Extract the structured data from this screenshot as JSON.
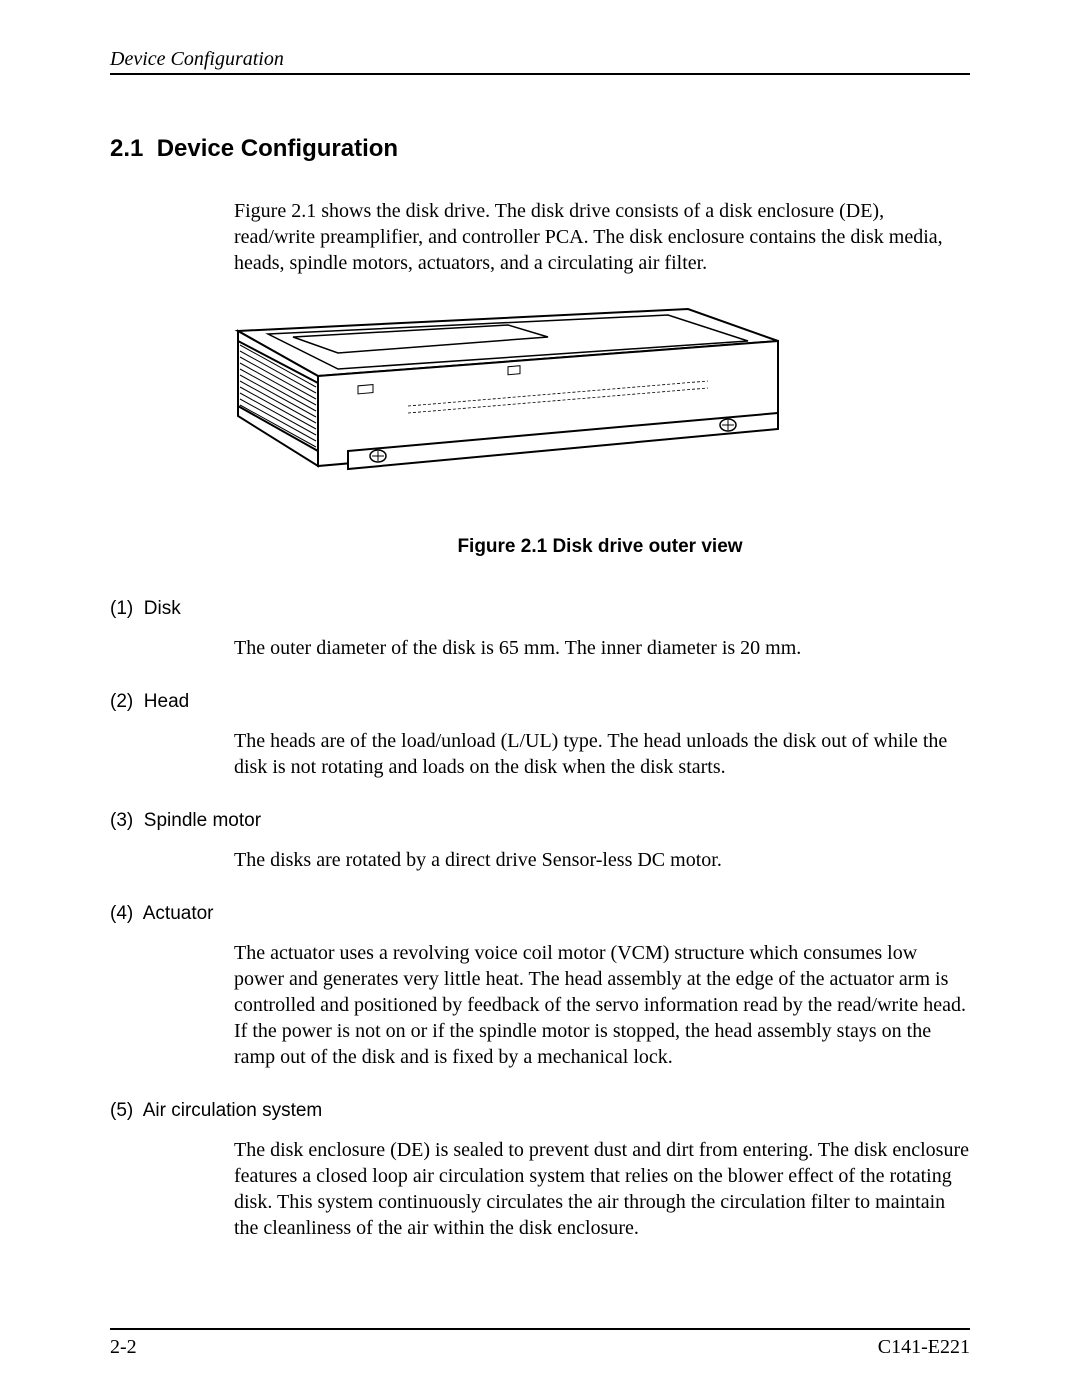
{
  "header": {
    "title": "Device Configuration"
  },
  "section": {
    "number": "2.1",
    "title": "Device Configuration",
    "intro": "Figure 2.1 shows the disk drive.  The disk drive consists of a disk enclosure (DE), read/write preamplifier, and controller PCA.  The disk enclosure contains the disk media, heads, spindle motors, actuators, and a circulating air filter."
  },
  "figure": {
    "caption": "Figure 2.1  Disk drive outer view"
  },
  "subsections": [
    {
      "number": "(1)",
      "title": "Disk",
      "text": "The outer diameter of the disk is 65 mm.  The inner diameter is 20 mm."
    },
    {
      "number": "(2)",
      "title": "Head",
      "text": "The heads are of the load/unload (L/UL) type.  The head unloads the disk out of while the disk is not rotating and loads on the disk when the disk starts."
    },
    {
      "number": "(3)",
      "title": "Spindle motor",
      "text": "The disks are rotated by a direct drive Sensor-less DC motor."
    },
    {
      "number": "(4)",
      "title": "Actuator",
      "text": "The actuator uses a revolving voice coil motor (VCM) structure which consumes low power and generates very little heat.  The head assembly at the edge of the actuator arm is controlled and positioned by feedback of the servo information read by the read/write head.  If the power is not on or if the spindle motor is stopped, the head assembly stays on the ramp out of the disk and is fixed by a mechanical lock."
    },
    {
      "number": "(5)",
      "title": "Air circulation system",
      "text": "The disk enclosure (DE) is sealed to prevent dust and dirt from entering.  The disk enclosure features a closed loop air circulation system that relies on the blower effect of the rotating disk.  This system continuously circulates the air through the circulation filter to maintain the cleanliness of the air within the disk enclosure."
    }
  ],
  "footer": {
    "page": "2-2",
    "doc": "C141-E221"
  }
}
